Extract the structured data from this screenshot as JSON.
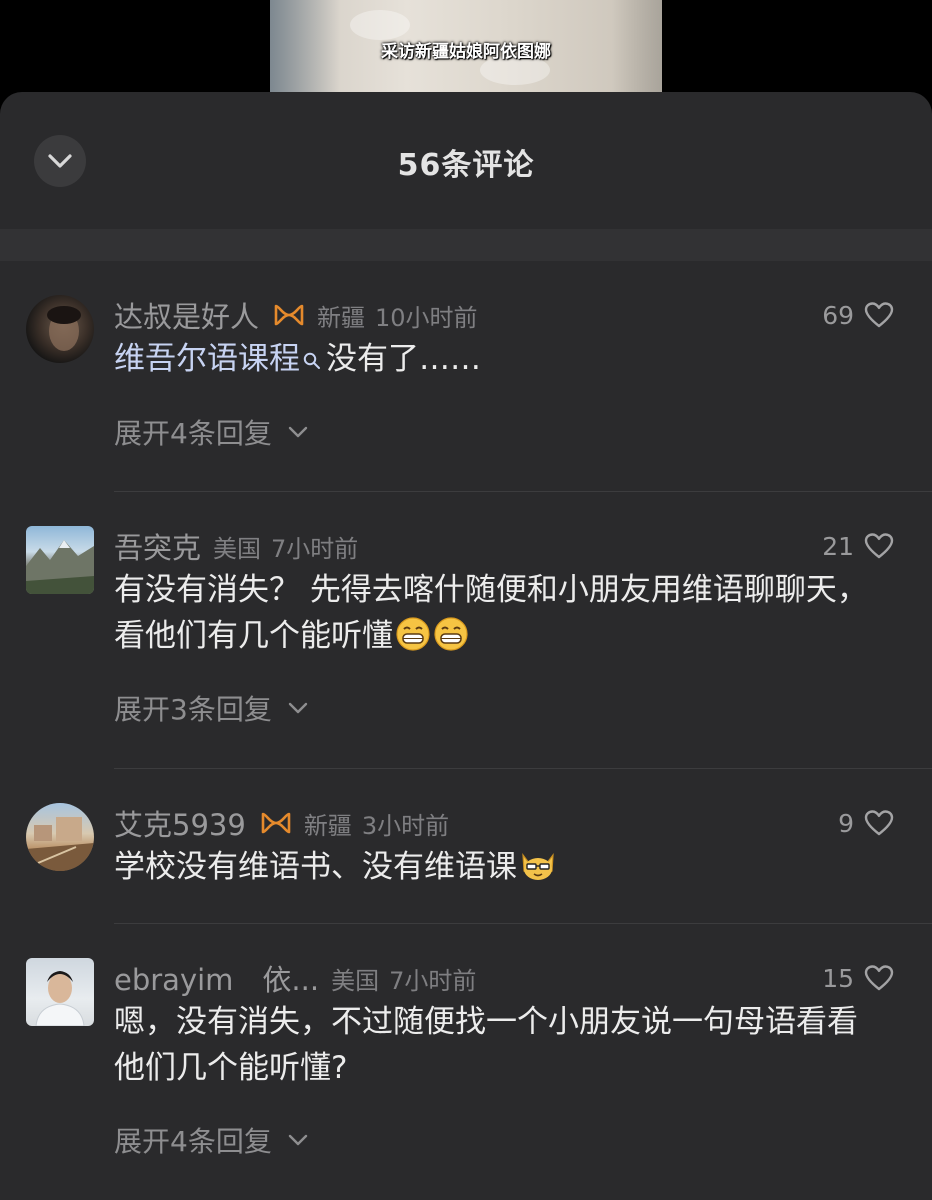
{
  "video": {
    "subtitle": "采访新疆姑娘阿依图娜"
  },
  "sheet": {
    "title": "56条评论",
    "collapse_icon": "chevron-down-icon"
  },
  "comments": [
    {
      "username": "达叔是好人",
      "badge": "fan-badge-icon",
      "location": "新疆",
      "time": "10小时前",
      "likes": "69",
      "text_link": "维吾尔语课程",
      "text_after": "没有了……",
      "expand": "展开4条回复"
    },
    {
      "username": "吾突克",
      "location": "美国",
      "time": "7小时前",
      "likes": "21",
      "text": "有没有消失？ 先得去喀什随便和小朋友用维语聊聊天，看他们有几个能听懂",
      "emojis": [
        "grin-emoji-icon",
        "grin-emoji-icon"
      ],
      "expand": "展开3条回复"
    },
    {
      "username": "艾克5939",
      "badge": "fan-badge-icon",
      "location": "新疆",
      "time": "3小时前",
      "likes": "9",
      "text": "学校没有维语书、没有维语课",
      "emojis": [
        "cat-emoji-icon"
      ]
    },
    {
      "username": "ebrayim　依...",
      "location": "美国",
      "time": "7小时前",
      "likes": "15",
      "text": "嗯，没有消失，不过随便找一个小朋友说一句母语看看他们几个能听懂?",
      "expand": "展开4条回复"
    }
  ],
  "colors": {
    "sheet_bg": "#2a2a2c",
    "badge_orange": "#e58a2c",
    "link_blue": "#c7d3f2"
  }
}
